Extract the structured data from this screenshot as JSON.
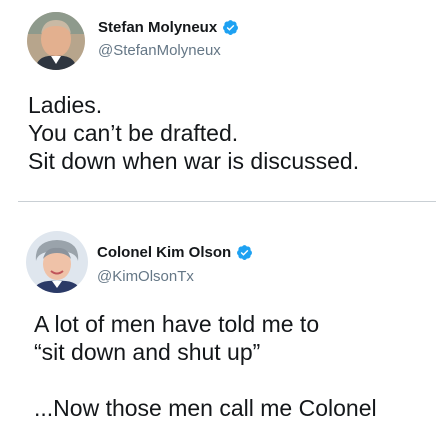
{
  "colors": {
    "verified_badge": "#1da1f2",
    "handle_text": "#657786",
    "body_text": "#14171a",
    "divider": "#c9cfd4"
  },
  "tweets": [
    {
      "display_name": "Stefan Molyneux",
      "handle": "@StefanMolyneux",
      "verified": true,
      "avatar_icon": "profile-photo",
      "text_lines": [
        "Ladies.",
        "You can’t be drafted.",
        "Sit down when war is discussed."
      ]
    },
    {
      "display_name": "Colonel Kim Olson",
      "handle": "@KimOlsonTx",
      "verified": true,
      "avatar_icon": "profile-photo",
      "text_lines": [
        "A lot of men have told me to",
        "“sit down and shut up”",
        "",
        "...Now those men call me Colonel"
      ]
    }
  ]
}
